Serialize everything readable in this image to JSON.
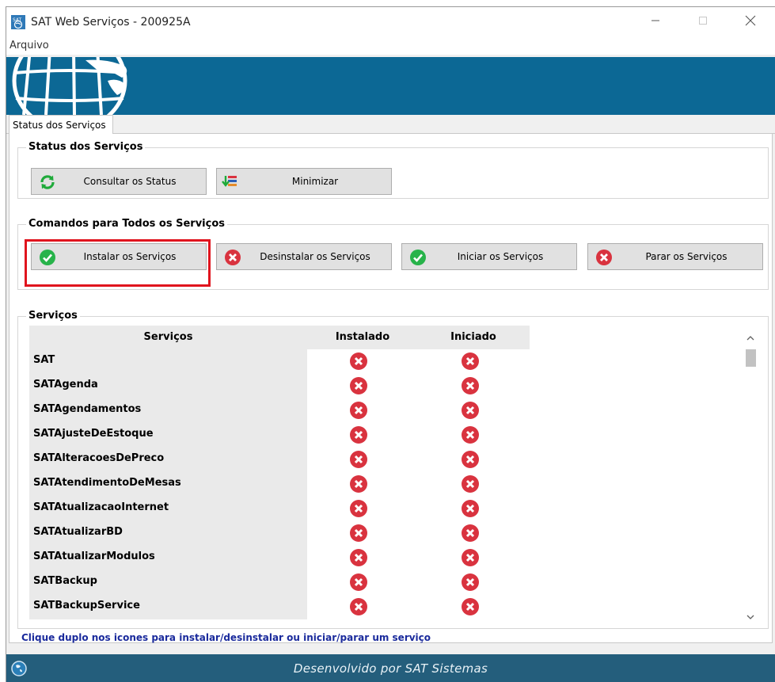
{
  "window": {
    "title": "SAT Web Serviços - 200925A"
  },
  "menu": {
    "items": [
      "Arquivo"
    ]
  },
  "tabs": [
    {
      "label": "Status dos Serviços",
      "active": true
    }
  ],
  "status_group": {
    "legend": "Status dos Serviços",
    "buttons": [
      {
        "label": "Consultar os Status",
        "icon": "refresh-icon"
      },
      {
        "label": "Minimizar",
        "icon": "minimize-to-tray-icon"
      }
    ]
  },
  "commands_group": {
    "legend": "Comandos para Todos os Serviços",
    "buttons": [
      {
        "label": "Instalar os Serviços",
        "icon": "check-icon",
        "highlighted": true
      },
      {
        "label": "Desinstalar os Serviços",
        "icon": "x-circle-icon"
      },
      {
        "label": "Iniciar os Serviços",
        "icon": "check-icon"
      },
      {
        "label": "Parar os Serviços",
        "icon": "x-circle-icon"
      }
    ]
  },
  "services_group": {
    "legend": "Serviços",
    "columns": [
      "Serviços",
      "Instalado",
      "Iniciado"
    ],
    "rows": [
      {
        "name": "SAT",
        "instalado": false,
        "iniciado": false
      },
      {
        "name": "SATAgenda",
        "instalado": false,
        "iniciado": false
      },
      {
        "name": "SATAgendamentos",
        "instalado": false,
        "iniciado": false
      },
      {
        "name": "SATAjusteDeEstoque",
        "instalado": false,
        "iniciado": false
      },
      {
        "name": "SATAlteracoesDePreco",
        "instalado": false,
        "iniciado": false
      },
      {
        "name": "SATAtendimentoDeMesas",
        "instalado": false,
        "iniciado": false
      },
      {
        "name": "SATAtualizacaoInternet",
        "instalado": false,
        "iniciado": false
      },
      {
        "name": "SATAtualizarBD",
        "instalado": false,
        "iniciado": false
      },
      {
        "name": "SATAtualizarModulos",
        "instalado": false,
        "iniciado": false
      },
      {
        "name": "SATBackup",
        "instalado": false,
        "iniciado": false
      },
      {
        "name": "SATBackupService",
        "instalado": false,
        "iniciado": false
      }
    ]
  },
  "hint": "Clique duplo nos icones para instalar/desinstalar ou iniciar/parar um serviço",
  "footer": {
    "text": "Desenvolvido por SAT Sistemas"
  },
  "colors": {
    "banner": "#0c6895",
    "footer": "#245e7c",
    "highlight": "#e0141e",
    "hint": "#1a2a9c",
    "status_red": "#d9333f",
    "status_green": "#27b34a"
  }
}
